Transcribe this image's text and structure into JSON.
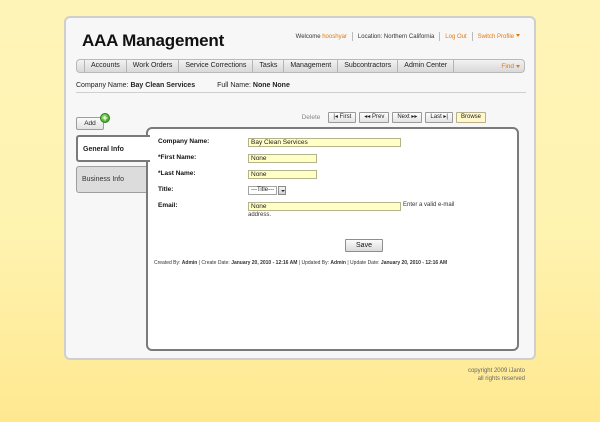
{
  "header": {
    "app_title": "AAA Management",
    "welcome_prefix": "Welcome ",
    "username": "hooshyar",
    "location": "Location: Northern California",
    "logout": "Log Out",
    "switch_profile": "Switch Profile"
  },
  "nav": {
    "items": [
      "Accounts",
      "Work Orders",
      "Service Corrections",
      "Tasks",
      "Management",
      "Subcontractors",
      "Admin Center"
    ],
    "find": "Find"
  },
  "company_bar": {
    "company_label": "Company Name:",
    "company_value": "Bay Clean Services",
    "full_name_label": "Full Name:",
    "full_name_value": "None None"
  },
  "toolbar": {
    "add": "Add",
    "delete": "Delete",
    "first": "First",
    "prev": "Prev",
    "next": "Next",
    "last": "Last",
    "browse": "Browse"
  },
  "tabs": [
    "General Info",
    "Business Info"
  ],
  "form": {
    "company_name_label": "Company Name:",
    "company_name_value": "Bay Clean Services",
    "first_name_label": "*First Name:",
    "first_name_value": "None",
    "last_name_label": "*Last Name:",
    "last_name_value": "None",
    "title_label": "Title:",
    "title_value": "---Title---",
    "email_label": "Email:",
    "email_value": "None",
    "email_hint_1": "Enter a valid e-mail",
    "email_hint_2": "address.",
    "save": "Save"
  },
  "audit": {
    "created_by_label": "Created By: ",
    "created_by": "Admin",
    "create_date_label": " | Create Date: ",
    "create_date": "January 20, 2010 - 12:16 AM",
    "updated_by_label": " | Updated By: ",
    "updated_by": "Admin",
    "update_date_label": " | Update Date: ",
    "update_date": "January 20, 2010 - 12:16 AM"
  },
  "footer": {
    "copyright_line1": "copyright 2009 iJanto",
    "copyright_line2": "all rights reserved"
  },
  "colors": {
    "accent_orange": "#e07a10",
    "field_yellow": "#ffffc6",
    "background_yellow": "#fff3b0"
  }
}
